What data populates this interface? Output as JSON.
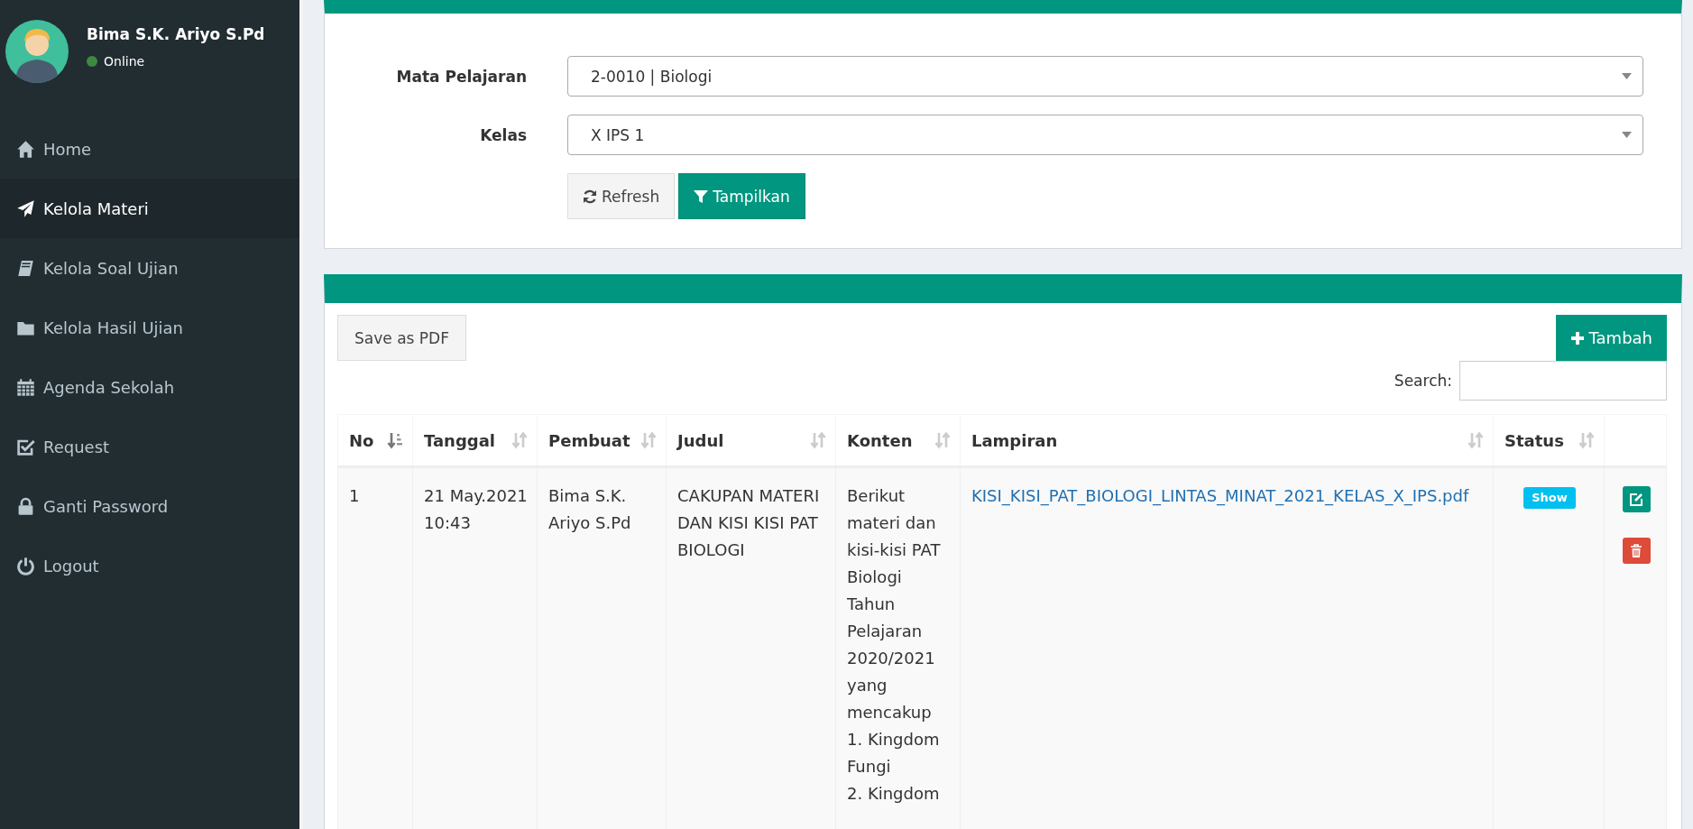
{
  "user": {
    "name": "Bima S.K. Ariyo S.Pd",
    "status": "Online",
    "online": true
  },
  "menu": [
    {
      "label": "Home",
      "selected": false
    },
    {
      "label": "Kelola Materi",
      "selected": true
    },
    {
      "label": "Kelola Soal Ujian",
      "selected": false
    },
    {
      "label": "Kelola Hasil Ujian",
      "selected": false
    },
    {
      "label": "Agenda Sekolah",
      "selected": false
    },
    {
      "label": "Request",
      "selected": false
    },
    {
      "label": "Ganti Password",
      "selected": false
    },
    {
      "label": "Logout",
      "selected": false
    }
  ],
  "filter": {
    "fields": [
      {
        "label": "Mata Pelajaran",
        "value": "2-0010 | Biologi"
      },
      {
        "label": "Kelas",
        "value": "X IPS 1"
      }
    ],
    "buttons": [
      {
        "label": "Refresh",
        "kind": "refresh"
      },
      {
        "label": "Tampilkan",
        "kind": "filter"
      }
    ]
  },
  "toolbar": {
    "export_button": "Save as PDF",
    "add_button": "Tambah",
    "search_label": "Search:"
  },
  "table": {
    "columns": [
      {
        "label": "No",
        "sorted": true
      },
      {
        "label": "Tanggal",
        "sorted": false
      },
      {
        "label": "Pembuat",
        "sorted": false
      },
      {
        "label": "Judul",
        "sorted": false
      },
      {
        "label": "Konten",
        "sorted": false
      },
      {
        "label": "Lampiran",
        "sorted": false
      },
      {
        "label": "Status",
        "sorted": false
      }
    ],
    "rows": [
      {
        "no": "1",
        "tanggal": "21 May.2021 10:43",
        "pembuat": "Bima S.K. Ariyo S.Pd",
        "judul": "CAKUPAN MATERI DAN KISI KISI PAT BIOLOGI",
        "konten": [
          "Berikut materi dan kisi-kisi PAT Biologi Tahun Pelajaran 2020/2021 yang mencakup",
          "1. Kingdom Fungi",
          "2. Kingdom"
        ],
        "lampiran": "KISI_KISI_PAT_BIOLOGI_LINTAS_MINAT_2021_KELAS_X_IPS.pdf",
        "status": "Show"
      }
    ]
  }
}
